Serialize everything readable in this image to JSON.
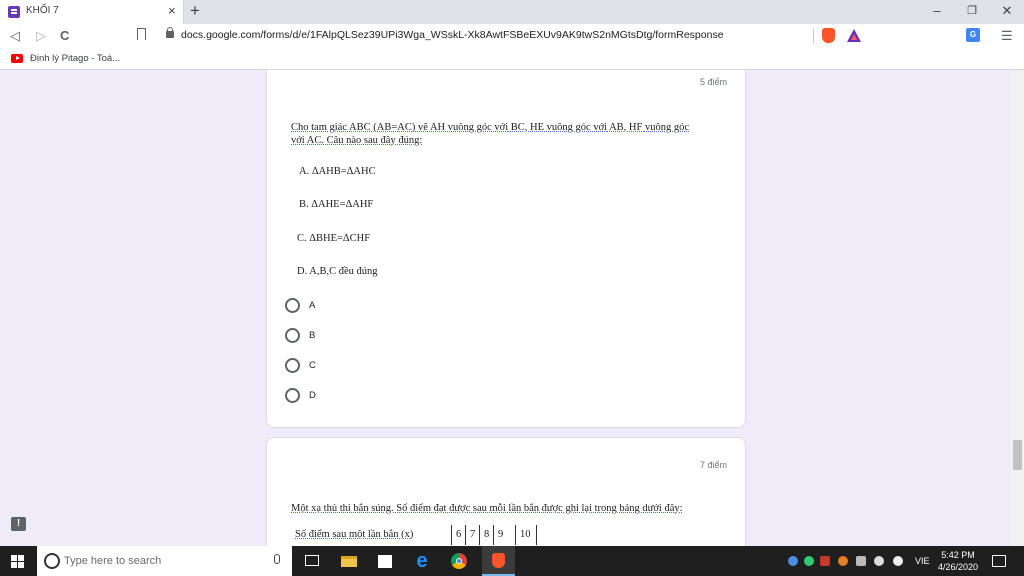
{
  "browser": {
    "tab_title": "KHỐI 7",
    "tab_close": "×",
    "new_tab": "+",
    "minimize": "–",
    "restore": "❐",
    "close": "✕",
    "back": "◁",
    "forward": "▷",
    "reload": "C",
    "url": "docs.google.com/forms/d/e/1FAlpQLSez39UPi3Wga_WSskL-Xk8AwtFSBeEXUv9AK9twS2nMGtsDtg/formResponse",
    "menu": "☰",
    "translate_glyph": "G",
    "bookmark_label": "Định lý Pitago - Toá..."
  },
  "question1": {
    "points": "5 điểm",
    "text_line1_words": [
      "Cho tam ",
      "giác",
      " ABC (AB=AC) ",
      "vẽ",
      " AH ",
      "vuông góc với",
      " BC, HE ",
      "vuông góc với",
      " AB, HF ",
      "vuông góc"
    ],
    "text_line2": "với AC. Câu nào sau đây đúng:",
    "statement_a": "A. ΔAHB=ΔAHC",
    "statement_b": "B. ΔAHE=ΔAHF",
    "statement_c": "C. ΔBHE=ΔCHF",
    "statement_d": "D. A,B,C đều đúng",
    "choices": [
      "A",
      "B",
      "C",
      "D"
    ]
  },
  "question2": {
    "points": "7 điểm",
    "text": "Một xạ thủ thi bắn súng. Số điểm đạt được sau mỗi lần bắn được ghi lại trong bảng dưới đây:",
    "table_label": "Số điểm sau một lần bắn (x)",
    "table_values": [
      "6",
      "7",
      "8",
      "9",
      "10"
    ]
  },
  "feedback_glyph": "!",
  "taskbar": {
    "search_placeholder": "Type here to search",
    "edge_glyph": "e",
    "language": "VIE",
    "time": "5:42 PM",
    "date": "4/26/2020"
  },
  "colors": {
    "page_background": "#f0ebf8",
    "taskbar": "#1f1f1f",
    "brave": "#fb542b"
  }
}
